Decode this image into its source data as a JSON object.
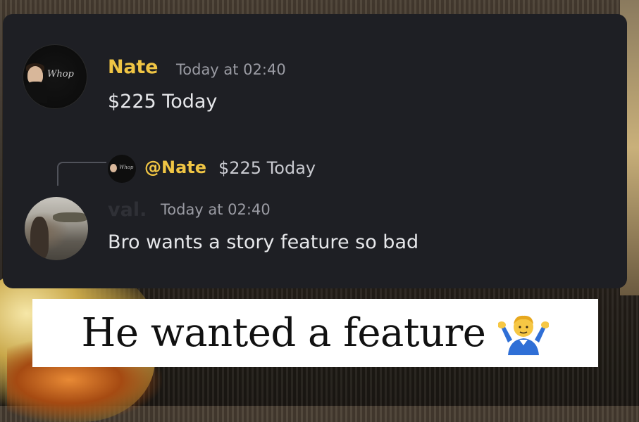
{
  "messages": [
    {
      "author": "Nate",
      "timestamp": "Today at 02:40",
      "text": "$225 Today",
      "author_color": "#f0c544",
      "avatar_text": "Whop"
    },
    {
      "reply": {
        "mention": "@Nate",
        "preview": "$225 Today",
        "avatar_text": "Whop"
      },
      "author": "val.",
      "timestamp": "Today at 02:40",
      "text": "Bro wants a story feature so bad",
      "author_color": "#2f3036"
    }
  ],
  "caption": {
    "text": "He wanted a feature",
    "emoji_icon": "person-shrugging-icon"
  },
  "colors": {
    "card_bg": "#1e1f24",
    "text": "#e6e7ea",
    "muted": "#9a9ba3",
    "accent": "#f0c544"
  }
}
